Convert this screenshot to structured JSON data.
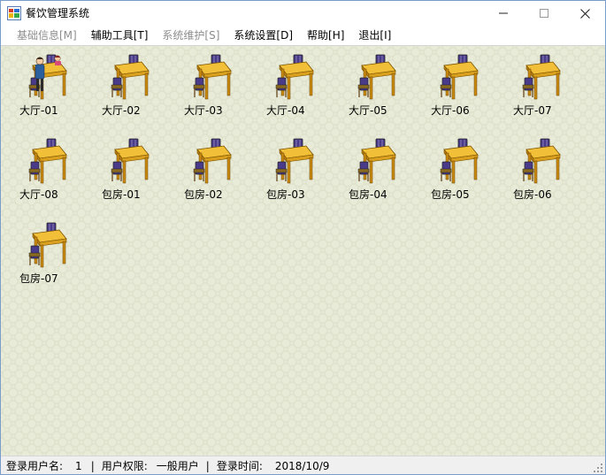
{
  "window": {
    "title": "餐饮管理系统"
  },
  "menu": [
    {
      "label": "基础信息[M]",
      "enabled": false
    },
    {
      "label": "辅助工具[T]",
      "enabled": true
    },
    {
      "label": "系统维护[S]",
      "enabled": false
    },
    {
      "label": "系统设置[D]",
      "enabled": true
    },
    {
      "label": "帮助[H]",
      "enabled": true
    },
    {
      "label": "退出[I]",
      "enabled": true
    }
  ],
  "tables": [
    {
      "label": "大厅-01",
      "occupied": true
    },
    {
      "label": "大厅-02",
      "occupied": false
    },
    {
      "label": "大厅-03",
      "occupied": false
    },
    {
      "label": "大厅-04",
      "occupied": false
    },
    {
      "label": "大厅-05",
      "occupied": false
    },
    {
      "label": "大厅-06",
      "occupied": false
    },
    {
      "label": "大厅-07",
      "occupied": false
    },
    {
      "label": "大厅-08",
      "occupied": false
    },
    {
      "label": "包房-01",
      "occupied": false
    },
    {
      "label": "包房-02",
      "occupied": false
    },
    {
      "label": "包房-03",
      "occupied": false
    },
    {
      "label": "包房-04",
      "occupied": false
    },
    {
      "label": "包房-05",
      "occupied": false
    },
    {
      "label": "包房-06",
      "occupied": false
    },
    {
      "label": "包房-07",
      "occupied": false
    }
  ],
  "status": {
    "user_label": "登录用户名:",
    "user_value": "1",
    "sep1": "|",
    "role_label": "用户权限:",
    "role_value": "一般用户",
    "sep2": "|",
    "time_label": "登录时间:",
    "time_value": "2018/10/9"
  },
  "colors": {
    "table_top": "#f2c038",
    "table_leg": "#c98a12",
    "chair": "#4a3a8a",
    "disabled_text": "#8d8d8d"
  }
}
